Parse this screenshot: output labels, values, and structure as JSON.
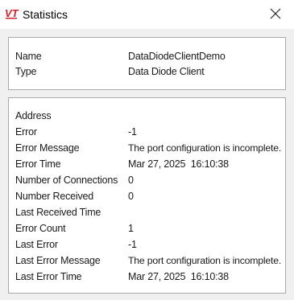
{
  "window": {
    "title": "Statistics",
    "icon": "vt-app-icon",
    "close_label": "✕"
  },
  "general": [
    {
      "label": "Name",
      "value": "DataDiodeClientDemo"
    },
    {
      "label": "Type",
      "value": "Data Diode Client"
    }
  ],
  "details": [
    {
      "label": "Address",
      "value": ""
    },
    {
      "label": "Error",
      "value": "-1"
    },
    {
      "label": "Error Message",
      "value": "The port configuration is incomplete."
    },
    {
      "label": "Error Time",
      "value": "Mar 27, 2025  16:10:38"
    },
    {
      "label": "Number of Connections",
      "value": "0"
    },
    {
      "label": "Number Received",
      "value": "0"
    },
    {
      "label": "Last Received Time",
      "value": ""
    },
    {
      "label": "Error Count",
      "value": "1"
    },
    {
      "label": "Last Error",
      "value": "-1"
    },
    {
      "label": "Last Error Message",
      "value": "The port configuration is incomplete."
    },
    {
      "label": "Last Error Time",
      "value": "Mar 27, 2025  16:10:38"
    }
  ],
  "colors": {
    "icon_red": "#d9202a",
    "border": "#a9a9a9",
    "background": "#f0f0f0"
  }
}
